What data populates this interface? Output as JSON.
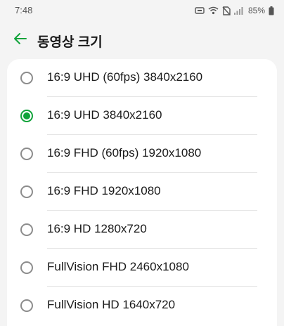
{
  "status_bar": {
    "time": "7:48",
    "battery": "85%"
  },
  "header": {
    "title": "동영상 크기",
    "back_icon": "arrow-left-icon"
  },
  "colors": {
    "accent": "#10a33a"
  },
  "options": [
    {
      "label": "16:9 UHD (60fps) 3840x2160",
      "selected": false
    },
    {
      "label": "16:9 UHD 3840x2160",
      "selected": true
    },
    {
      "label": "16:9 FHD (60fps) 1920x1080",
      "selected": false
    },
    {
      "label": "16:9 FHD 1920x1080",
      "selected": false
    },
    {
      "label": "16:9 HD 1280x720",
      "selected": false
    },
    {
      "label": "FullVision FHD 2460x1080",
      "selected": false
    },
    {
      "label": "FullVision HD 1640x720",
      "selected": false
    }
  ]
}
